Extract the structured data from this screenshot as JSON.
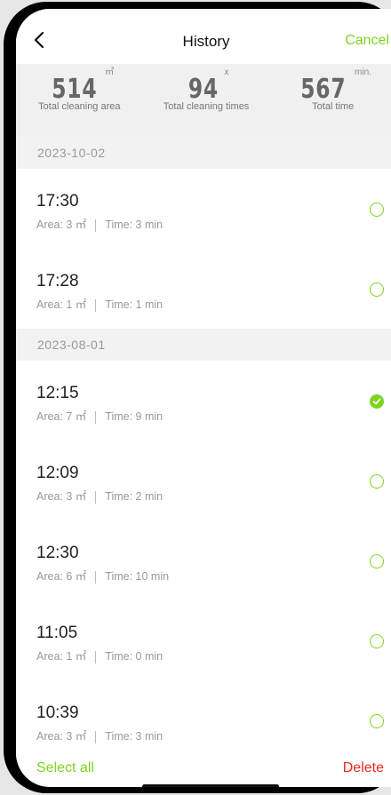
{
  "header": {
    "title": "History",
    "cancel_label": "Cancel",
    "back_icon": "chevron-left-icon"
  },
  "stats": [
    {
      "value": "514",
      "unit": "㎡",
      "label": "Total cleaning area"
    },
    {
      "value": "94",
      "unit": "x",
      "label": "Total cleaning times"
    },
    {
      "value": "567",
      "unit": "min.",
      "label": "Total time"
    }
  ],
  "groups": [
    {
      "date": "2023-10-02",
      "records": [
        {
          "time": "17:30",
          "area": "Area: 3 ㎡",
          "duration": "Time: 3 min",
          "selected": false
        },
        {
          "time": "17:28",
          "area": "Area: 1 ㎡",
          "duration": "Time: 1 min",
          "selected": false
        }
      ]
    },
    {
      "date": "2023-08-01",
      "records": [
        {
          "time": "12:15",
          "area": "Area: 7 ㎡",
          "duration": "Time: 9 min",
          "selected": true
        },
        {
          "time": "12:09",
          "area": "Area: 3 ㎡",
          "duration": "Time: 2 min",
          "selected": false
        },
        {
          "time": "12:30",
          "area": "Area: 6 ㎡",
          "duration": "Time: 10 min",
          "selected": false
        },
        {
          "time": "11:05",
          "area": "Area: 1 ㎡",
          "duration": "Time: 0 min",
          "selected": false
        },
        {
          "time": "10:39",
          "area": "Area: 3 ㎡",
          "duration": "Time: 3 min",
          "selected": false
        }
      ]
    }
  ],
  "footer": {
    "select_all_label": "Select all",
    "delete_label": "Delete"
  },
  "colors": {
    "accent": "#7ed321",
    "danger": "#e5281d"
  }
}
